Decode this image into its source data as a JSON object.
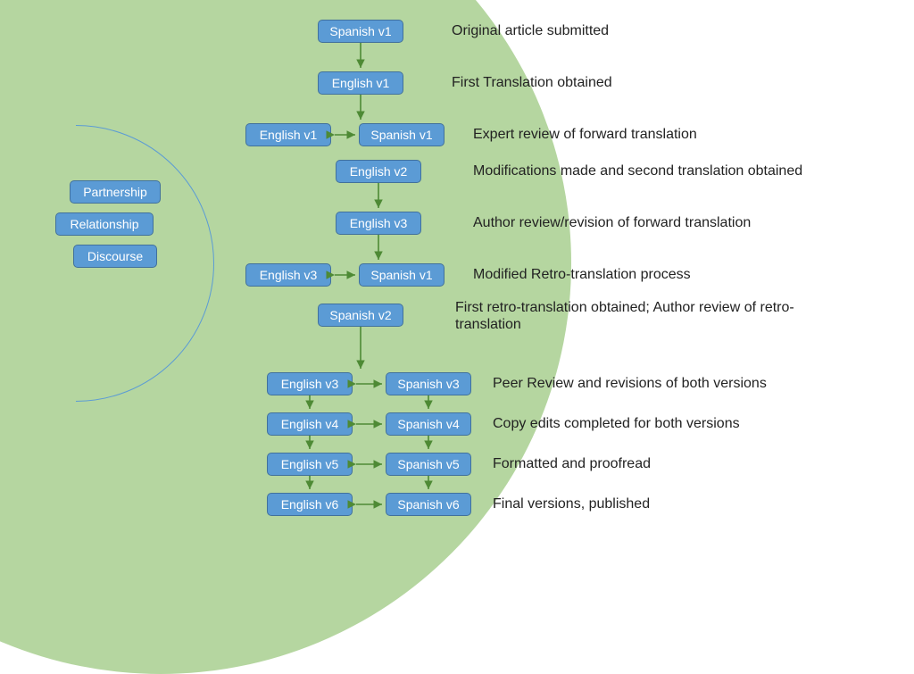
{
  "concepts": {
    "partnership": "Partnership",
    "relationship": "Relationship",
    "discourse": "Discourse"
  },
  "nodes": {
    "n1": "Spanish v1",
    "n2": "English v1",
    "n3a": "English v1",
    "n3b": "Spanish v1",
    "n4": "English v2",
    "n5": "English v3",
    "n6a": "English v3",
    "n6b": "Spanish v1",
    "n7": "Spanish v2",
    "n8a": "English v3",
    "n8b": "Spanish v3",
    "n9a": "English v4",
    "n9b": "Spanish v4",
    "n10a": "English v5",
    "n10b": "Spanish v5",
    "n11a": "English v6",
    "n11b": "Spanish v6"
  },
  "steps": {
    "s1": "Original article submitted",
    "s2": "First Translation obtained",
    "s3": "Expert review of forward translation",
    "s4": "Modifications made and second translation obtained",
    "s5": "Author review/revision of forward translation",
    "s6": "Modified Retro-translation process",
    "s7": "First retro-translation obtained; Author review of retro-translation",
    "s8": "Peer Review and revisions of both versions",
    "s9": "Copy edits completed for both versions",
    "s10": "Formatted and proofread",
    "s11": "Final versions, published"
  }
}
